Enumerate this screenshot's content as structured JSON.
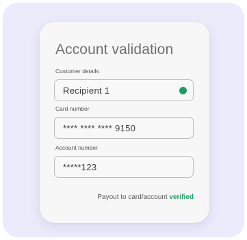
{
  "title": "Account validation",
  "fields": [
    {
      "label": "Customer details",
      "value": "Recipient 1",
      "status_color": "#1f9a63"
    },
    {
      "label": "Card number",
      "value": "**** **** ****  9150"
    },
    {
      "label": "Account number",
      "value": "*****123"
    }
  ],
  "footer": {
    "text": "Payout to card/account ",
    "status": "verified",
    "status_color": "#1f9a63"
  }
}
